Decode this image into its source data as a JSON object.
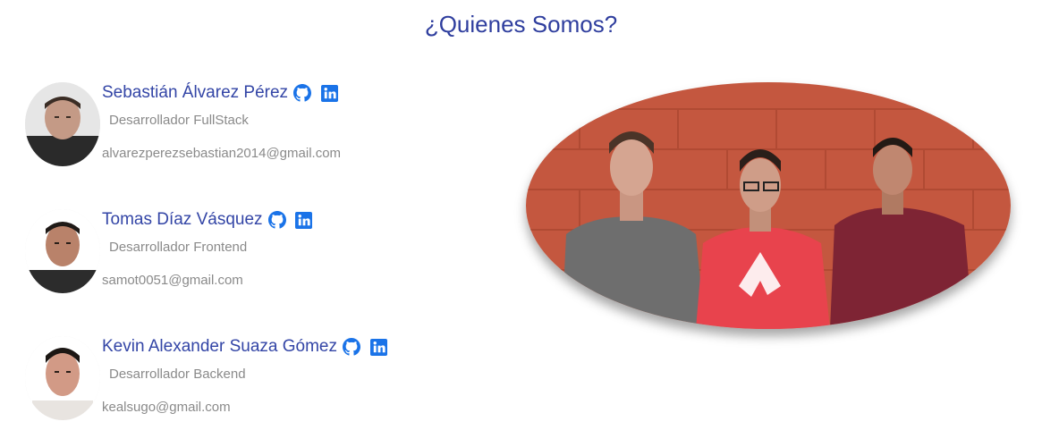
{
  "page": {
    "title": "¿Quienes Somos?"
  },
  "members": [
    {
      "name": "Sebastián Álvarez Pérez",
      "role": "Desarrollador FullStack",
      "email": "alvarezperezsebastian2014@gmail.com"
    },
    {
      "name": "Tomas Díaz Vásquez",
      "role": "Desarrollador Frontend",
      "email": "samot0051@gmail.com"
    },
    {
      "name": "Kevin Alexander Suaza Gómez",
      "role": "Desarrollador Backend",
      "email": "kealsugo@gmail.com"
    }
  ],
  "icons": {
    "github": "github-icon",
    "linkedin": "linkedin-icon"
  },
  "colors": {
    "title": "#2f3e9e",
    "name": "#3345a6",
    "icon": "#1a73e8",
    "muted": "#8a8a8a",
    "wall": "#c4573f"
  }
}
